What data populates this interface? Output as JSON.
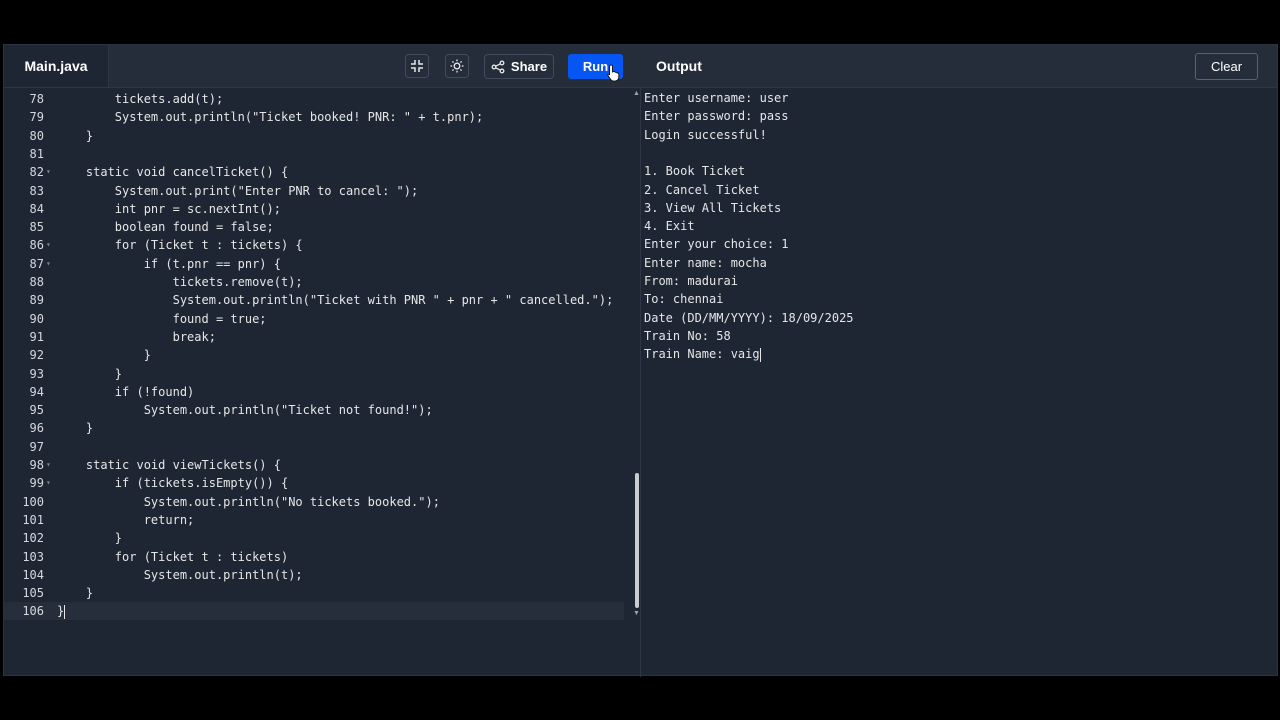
{
  "header": {
    "file_tab": "Main.java",
    "share_label": "Share",
    "run_label": "Run",
    "output_title": "Output",
    "clear_label": "Clear"
  },
  "editor": {
    "lines": [
      {
        "n": "78",
        "indent": "        ",
        "text": "tickets.add(t);"
      },
      {
        "n": "79",
        "indent": "        ",
        "text": "System.out.println(\"Ticket booked! PNR: \" + t.pnr);"
      },
      {
        "n": "80",
        "indent": "    ",
        "text": "}"
      },
      {
        "n": "81",
        "indent": "",
        "text": ""
      },
      {
        "n": "82",
        "indent": "    ",
        "text": "static void cancelTicket() {",
        "fold": true
      },
      {
        "n": "83",
        "indent": "        ",
        "text": "System.out.print(\"Enter PNR to cancel: \");"
      },
      {
        "n": "84",
        "indent": "        ",
        "text": "int pnr = sc.nextInt();"
      },
      {
        "n": "85",
        "indent": "        ",
        "text": "boolean found = false;"
      },
      {
        "n": "86",
        "indent": "        ",
        "text": "for (Ticket t : tickets) {",
        "fold": true
      },
      {
        "n": "87",
        "indent": "            ",
        "text": "if (t.pnr == pnr) {",
        "fold": true
      },
      {
        "n": "88",
        "indent": "                ",
        "text": "tickets.remove(t);"
      },
      {
        "n": "89",
        "indent": "                ",
        "text": "System.out.println(\"Ticket with PNR \" + pnr + \" cancelled.\");"
      },
      {
        "n": "90",
        "indent": "                ",
        "text": "found = true;"
      },
      {
        "n": "91",
        "indent": "                ",
        "text": "break;"
      },
      {
        "n": "92",
        "indent": "            ",
        "text": "}"
      },
      {
        "n": "93",
        "indent": "        ",
        "text": "}"
      },
      {
        "n": "94",
        "indent": "        ",
        "text": "if (!found)"
      },
      {
        "n": "95",
        "indent": "            ",
        "text": "System.out.println(\"Ticket not found!\");"
      },
      {
        "n": "96",
        "indent": "    ",
        "text": "}"
      },
      {
        "n": "97",
        "indent": "",
        "text": ""
      },
      {
        "n": "98",
        "indent": "    ",
        "text": "static void viewTickets() {",
        "fold": true
      },
      {
        "n": "99",
        "indent": "        ",
        "text": "if (tickets.isEmpty()) {",
        "fold": true
      },
      {
        "n": "100",
        "indent": "            ",
        "text": "System.out.println(\"No tickets booked.\");"
      },
      {
        "n": "101",
        "indent": "            ",
        "text": "return;"
      },
      {
        "n": "102",
        "indent": "        ",
        "text": "}"
      },
      {
        "n": "103",
        "indent": "        ",
        "text": "for (Ticket t : tickets)"
      },
      {
        "n": "104",
        "indent": "            ",
        "text": "System.out.println(t);"
      },
      {
        "n": "105",
        "indent": "    ",
        "text": "}"
      },
      {
        "n": "106",
        "indent": "",
        "text": "}",
        "active": true
      }
    ]
  },
  "output": {
    "lines": [
      "Enter username: user",
      "Enter password: pass",
      "Login successful!",
      "",
      "1. Book Ticket",
      "2. Cancel Ticket",
      "3. View All Tickets",
      "4. Exit",
      "Enter your choice: 1",
      "Enter name: mocha",
      "From: madurai",
      "To: chennai",
      "Date (DD/MM/YYYY): 18/09/2025",
      "Train No: 58",
      "Train Name: vaig"
    ]
  },
  "colors": {
    "run_button": "#0556f3",
    "panel_bg": "#1e2533",
    "header_bg": "#252c3a"
  },
  "icons": [
    "collapse-icon",
    "sun-icon",
    "share-icon",
    "pointer-cursor-icon"
  ]
}
